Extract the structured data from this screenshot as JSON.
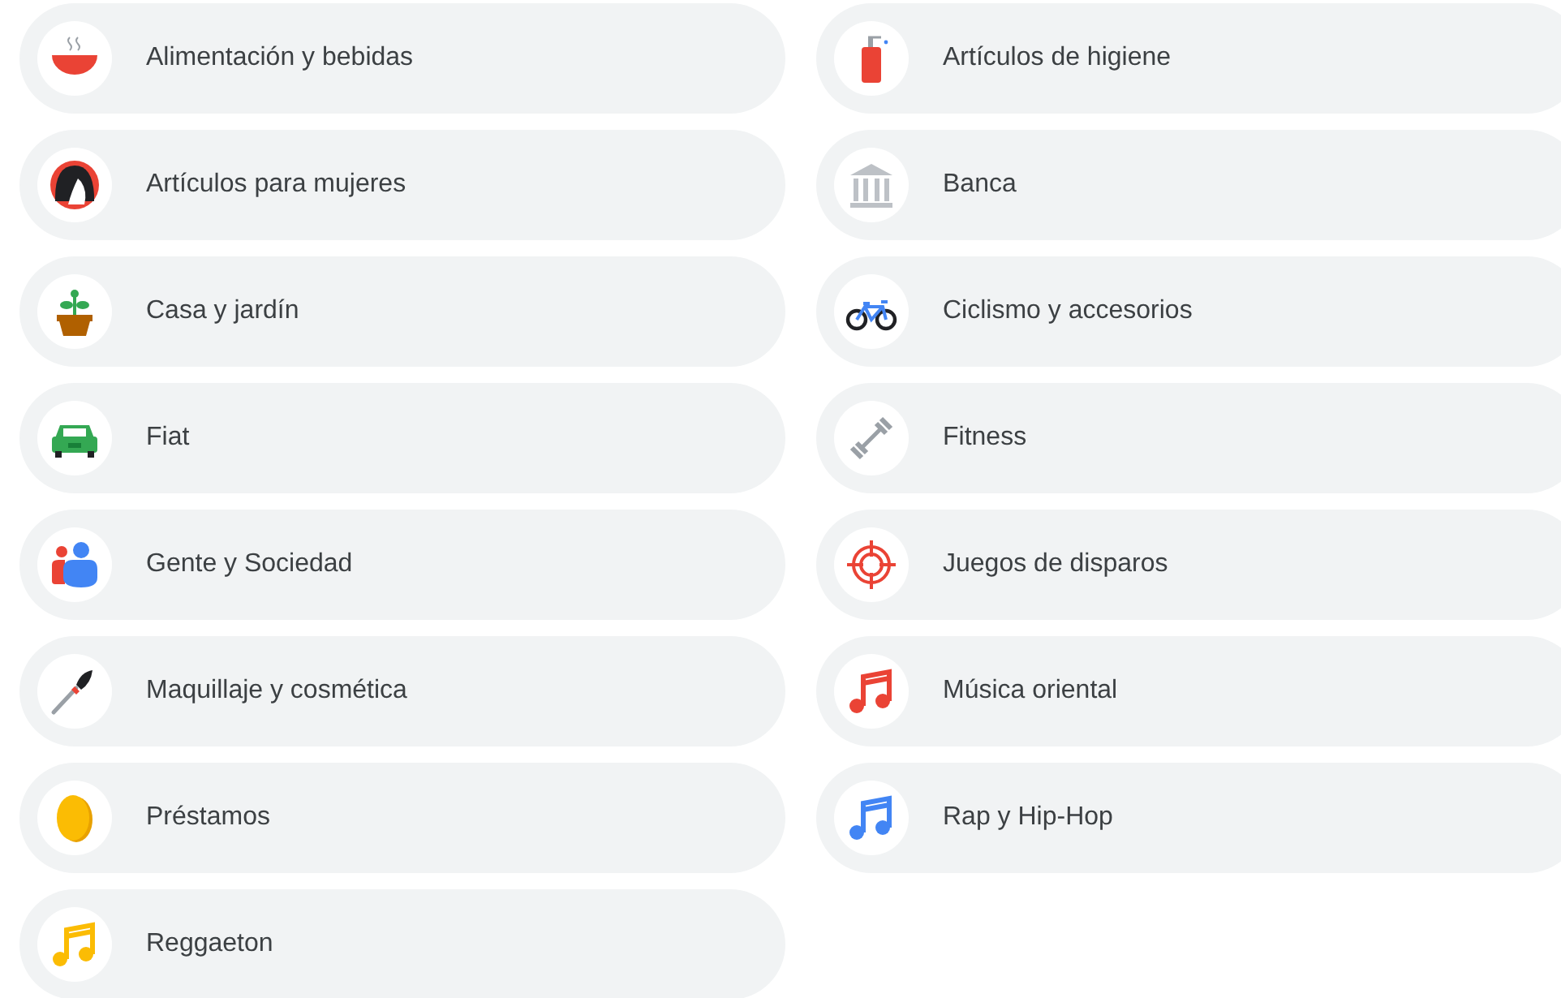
{
  "categories": [
    {
      "label": "Alimentación y bebidas",
      "kind": "bowl"
    },
    {
      "label": "Artículos de higiene",
      "kind": "bottle"
    },
    {
      "label": "Artículos para mujeres",
      "kind": "woman"
    },
    {
      "label": "Banca",
      "kind": "bank"
    },
    {
      "label": "Casa y jardín",
      "kind": "plant"
    },
    {
      "label": "Ciclismo y accesorios",
      "kind": "bike"
    },
    {
      "label": "Fiat",
      "kind": "car"
    },
    {
      "label": "Fitness",
      "kind": "dumbbell"
    },
    {
      "label": "Gente y Sociedad",
      "kind": "people"
    },
    {
      "label": "Juegos de disparos",
      "kind": "target"
    },
    {
      "label": "Maquillaje y cosmética",
      "kind": "brush"
    },
    {
      "label": "Música oriental",
      "kind": "note",
      "color": "#ea4335"
    },
    {
      "label": "Préstamos",
      "kind": "coin"
    },
    {
      "label": "Rap y Hip-Hop",
      "kind": "note",
      "color": "#4285f4"
    },
    {
      "label": "Reggaeton",
      "kind": "note",
      "color": "#fbbc04"
    }
  ]
}
